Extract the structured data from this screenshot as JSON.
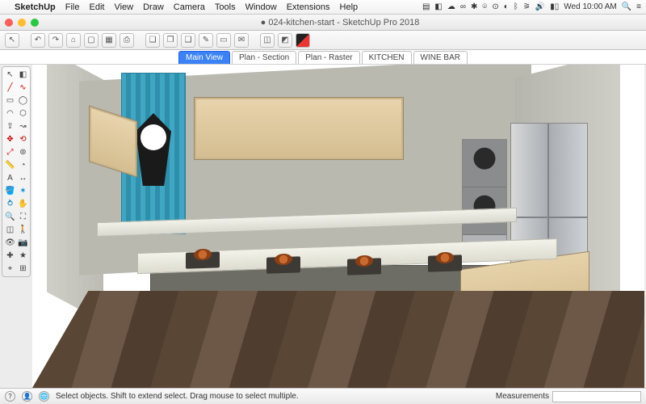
{
  "mac": {
    "app_name": "SketchUp",
    "menus": [
      "File",
      "Edit",
      "View",
      "Draw",
      "Camera",
      "Tools",
      "Window",
      "Extensions",
      "Help"
    ],
    "clock": "Wed 10:00 AM"
  },
  "window": {
    "title": "024-kitchen-start - SketchUp Pro 2018",
    "edited_dot": "●"
  },
  "scenes": {
    "items": [
      "Main View",
      "Plan - Section",
      "Plan - Raster",
      "KITCHEN",
      "WINE BAR"
    ],
    "active_index": 0
  },
  "status": {
    "hint": "Select objects. Shift to extend select. Drag mouse to select multiple.",
    "measurements_label": "Measurements",
    "measurements_value": ""
  },
  "toolbar_main": {
    "icons": [
      "pointer",
      "undo",
      "redo",
      "home",
      "box",
      "cube",
      "print",
      "sep",
      "layers",
      "layers2",
      "layers3",
      "book",
      "doc",
      "email",
      "sep",
      "cube2",
      "cube3",
      "swatch"
    ]
  },
  "palette": {
    "tools": [
      "select",
      "eraser",
      "line",
      "arc",
      "rect",
      "circle",
      "pushpull",
      "move",
      "rotate",
      "scale",
      "offset",
      "tape",
      "protractor",
      "text",
      "paint",
      "orbit",
      "pan",
      "zoom",
      "zoomext",
      "section",
      "axes",
      "dims",
      "walk",
      "look",
      "position",
      "sandbox",
      "solid",
      "follow",
      "3dtext",
      "extA",
      "extB",
      "extC"
    ]
  }
}
